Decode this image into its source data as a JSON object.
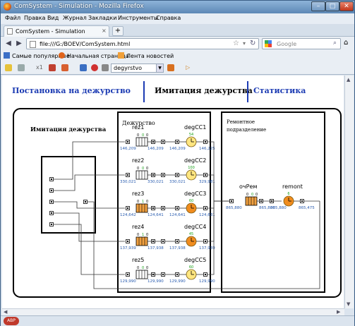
{
  "window": {
    "title": "ComSystem - Simulation - Mozilla Firefox",
    "min": "–",
    "max": "□",
    "close": "✕"
  },
  "menu": [
    "Файл",
    "Правка",
    "Вид",
    "Журнал",
    "Закладки",
    "Инструменты",
    "Справка"
  ],
  "tab": {
    "label": "ComSystem - Simulation",
    "close": "×",
    "new": "+"
  },
  "nav": {
    "back": "◀",
    "forward": "▶",
    "url": "file:///G:/BOEV/ComSystem.html",
    "search_placeholder": "Google",
    "home": "⌂"
  },
  "bookmarks": [
    {
      "label": "Самые популярные",
      "color": "#3b6fc6"
    },
    {
      "label": "Начальная страница",
      "color": "#e0641b"
    },
    {
      "label": "Лента новостей",
      "color": "#f0a03a"
    }
  ],
  "toolbar": {
    "x1": "x1",
    "select_value": "degyrstvo"
  },
  "page_nav": {
    "link1": "Постановка на дежурство",
    "current": "Имитация дежурства",
    "link3": "Статистика"
  },
  "sim": {
    "box_left_title": "Имитация дежурства",
    "box_mid_title": "Дежурство",
    "box_right_title_1": "Ремонтное",
    "box_right_title_2": "подразделение",
    "rows": [
      {
        "res": "rez1",
        "deg": "degCC1",
        "p": "0",
        "q": "0",
        "r": "0",
        "busy": false,
        "gauge": "54",
        "in": "146,209",
        "mid1": "146,209",
        "mid2": "146,209",
        "out": "146,225"
      },
      {
        "res": "rez2",
        "deg": "degCC2",
        "p": "0",
        "q": "0",
        "r": "0",
        "busy": false,
        "gauge": "100",
        "in": "330,021",
        "mid1": "330,021",
        "mid2": "330,021",
        "out": "329,981"
      },
      {
        "res": "rez3",
        "deg": "degCC3",
        "p": "0",
        "q": "1",
        "r": "0",
        "busy": true,
        "gauge": "60",
        "in": "124,642",
        "mid1": "124,641",
        "mid2": "124,641",
        "out": "124,631"
      },
      {
        "res": "rez4",
        "deg": "degCC4",
        "p": "0",
        "q": "1",
        "r": "0",
        "busy": true,
        "gauge": "45",
        "in": "137,939",
        "mid1": "137,938",
        "mid2": "137,938",
        "out": "137,939"
      },
      {
        "res": "rez5",
        "deg": "degCC5",
        "p": "0",
        "q": "0",
        "r": "0",
        "busy": false,
        "gauge": "60",
        "in": "129,990",
        "mid1": "129,990",
        "mid2": "129,990",
        "out": "129,990"
      }
    ],
    "queue": {
      "label": "очРем",
      "p": "0",
      "q": "0",
      "r": "0",
      "in": "865,880",
      "out1": "865,880",
      "out2": "865,880"
    },
    "remont": {
      "label": "remont",
      "gauge": "6",
      "out": "865,475"
    },
    "colors": {
      "gauge_idle": "#ffe680",
      "gauge_busy": "#f08c1e",
      "queue_busy": "#f0a040",
      "value_text": "#2a5db0",
      "counter": "#19a019"
    }
  }
}
